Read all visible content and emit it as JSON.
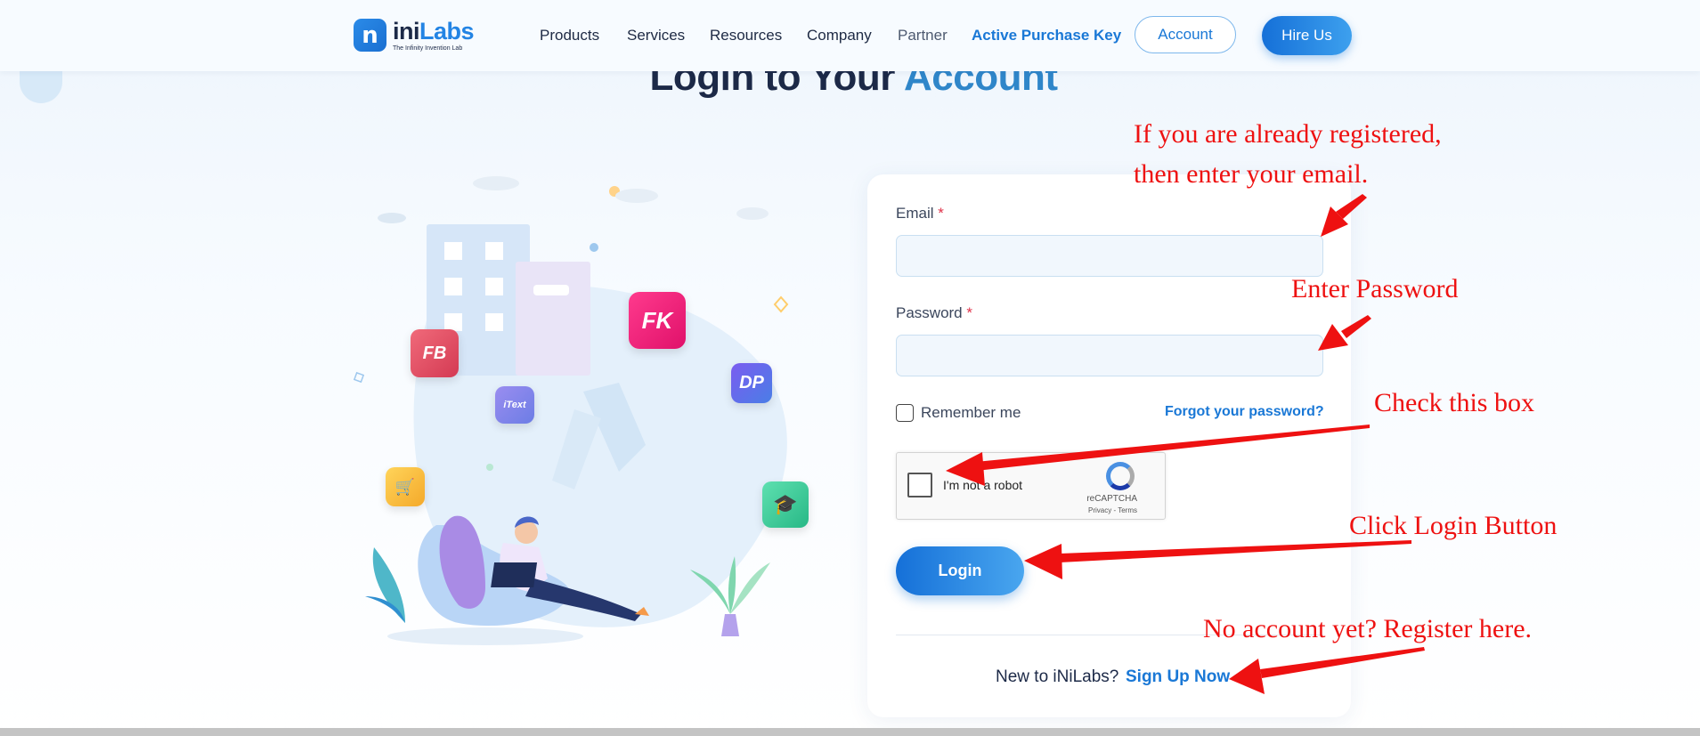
{
  "header": {
    "logo_name_prefix": "ini",
    "logo_name_suffix": "Labs",
    "logo_tagline": "The Infinity Invention Lab",
    "logo_mark": "n",
    "nav": [
      "Products",
      "Services",
      "Resources",
      "Company",
      "Partner",
      "Active Purchase Key"
    ],
    "account_label": "Account",
    "hire_label": "Hire Us"
  },
  "page": {
    "title_prefix": "Login to Your",
    "title_accent": "Account"
  },
  "illustration": {
    "icons": [
      "FB",
      "FK",
      "iText",
      "DP",
      "cart",
      "graduation"
    ]
  },
  "form": {
    "email_label": "Email",
    "password_label": "Password",
    "required_mark": "*",
    "email_value": "",
    "password_value": "",
    "remember_label": "Remember me",
    "forgot_label": "Forgot your password?",
    "recaptcha_label": "I'm not a robot",
    "recaptcha_brand": "reCAPTCHA",
    "recaptcha_terms": "Privacy - Terms",
    "login_label": "Login",
    "signup_prompt": "New to iNiLabs?",
    "signup_link": "Sign Up Now"
  },
  "annotations": {
    "email_note_line1": "If you are already registered,",
    "email_note_line2": "then enter your email.",
    "password_note": "Enter Password",
    "checkbox_note": "Check this box",
    "login_note": "Click Login Button",
    "register_note": "No account yet? Register here."
  },
  "colors": {
    "brand": "#1a78d6",
    "annotation": "#ee1111",
    "required": "#e0334a"
  }
}
